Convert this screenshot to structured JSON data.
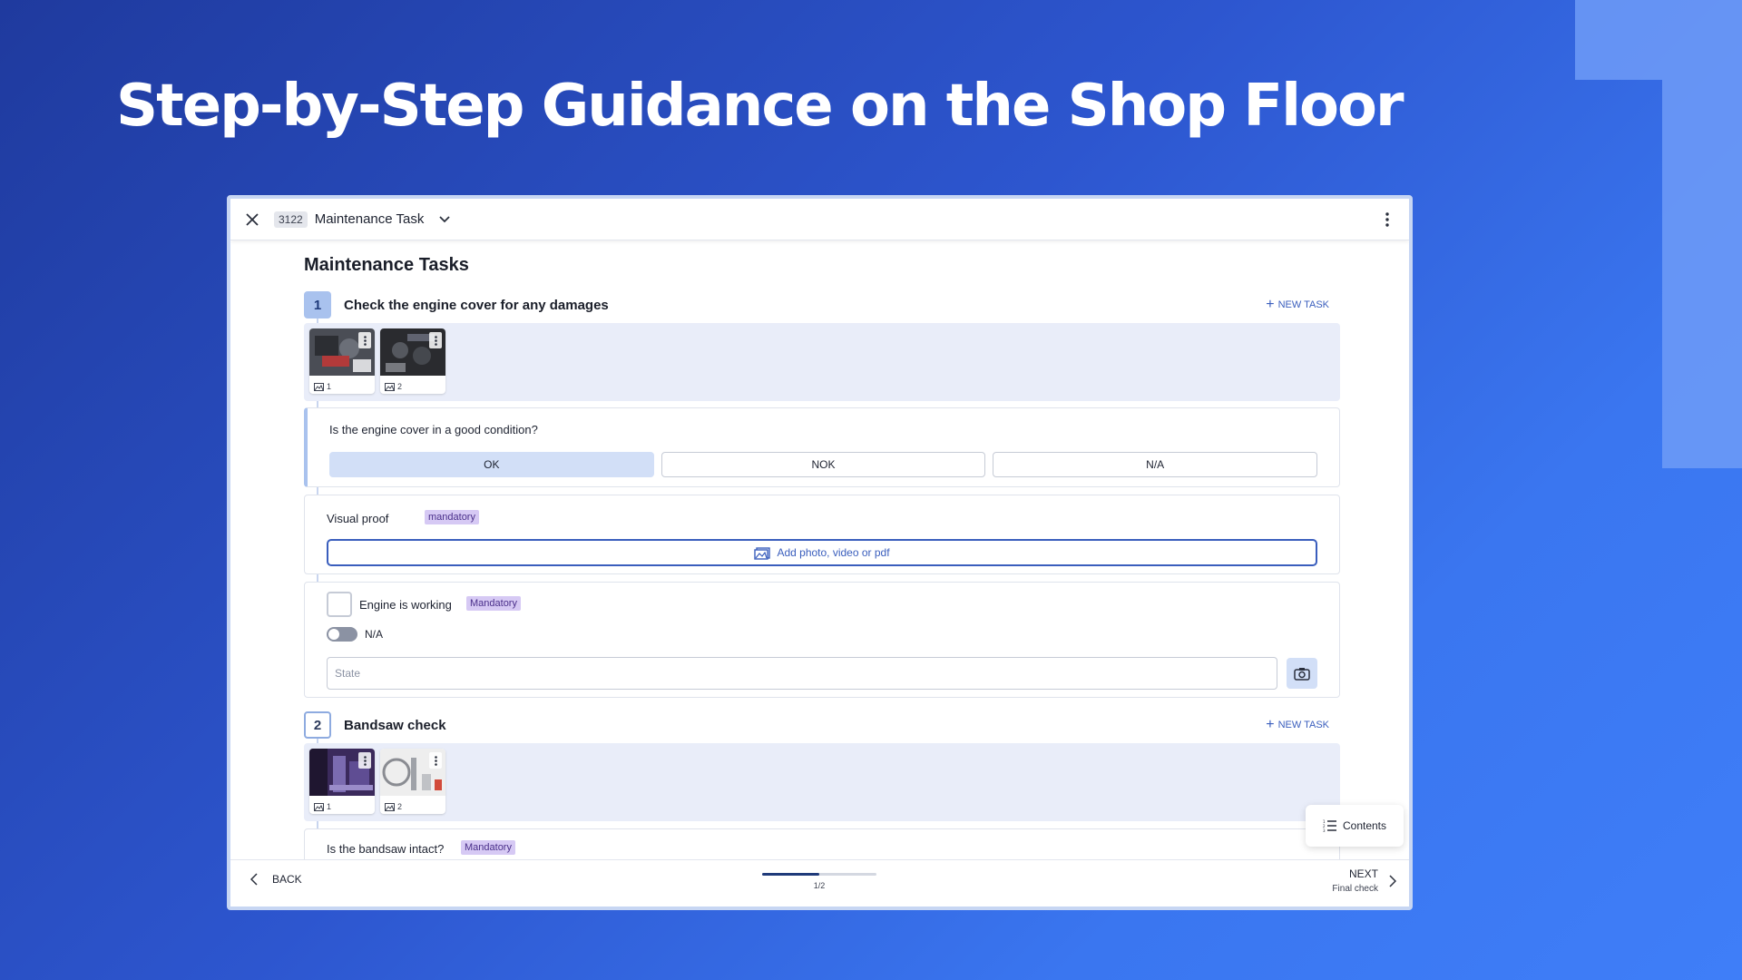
{
  "slide": {
    "title": "Step-by-Step Guidance on the Shop Floor"
  },
  "window": {
    "task_id": "3122",
    "task_title": "Maintenance Task"
  },
  "section_heading": "Maintenance Tasks",
  "steps": [
    {
      "number": "1",
      "title": "Check the engine cover for any damages",
      "new_task_label": "NEW TASK",
      "media": [
        {
          "caption": "1",
          "icon": "image-icon"
        },
        {
          "caption": "2",
          "icon": "image-icon"
        }
      ],
      "question": "Is the engine cover in a good condition?",
      "choices": [
        "OK",
        "NOK",
        "N/A"
      ],
      "selected_choice": "OK",
      "visual_proof": {
        "label": "Visual proof",
        "tag": "mandatory",
        "upload_label": "Add photo, video or pdf"
      },
      "check": {
        "label": "Engine is working",
        "tag": "Mandatory",
        "na_label": "N/A",
        "na_toggle_on": false,
        "state_placeholder": "State",
        "state_value": ""
      }
    },
    {
      "number": "2",
      "title": "Bandsaw check",
      "new_task_label": "NEW TASK",
      "media": [
        {
          "caption": "1",
          "icon": "image-icon"
        },
        {
          "caption": "2",
          "icon": "image-icon"
        }
      ],
      "question": "Is the bandsaw intact?",
      "question_tag": "Mandatory"
    }
  ],
  "contents_button": "Contents",
  "footer": {
    "back_label": "BACK",
    "progress_label": "1/2",
    "progress_fraction": 0.5,
    "next_label": "NEXT",
    "next_sublabel": "Final check"
  },
  "colors": {
    "accent": "#3a5ebd",
    "selected_choice": "#d2dff7",
    "mandatory_tag": "#d6c9f4",
    "media_strip": "#e9edf9"
  }
}
